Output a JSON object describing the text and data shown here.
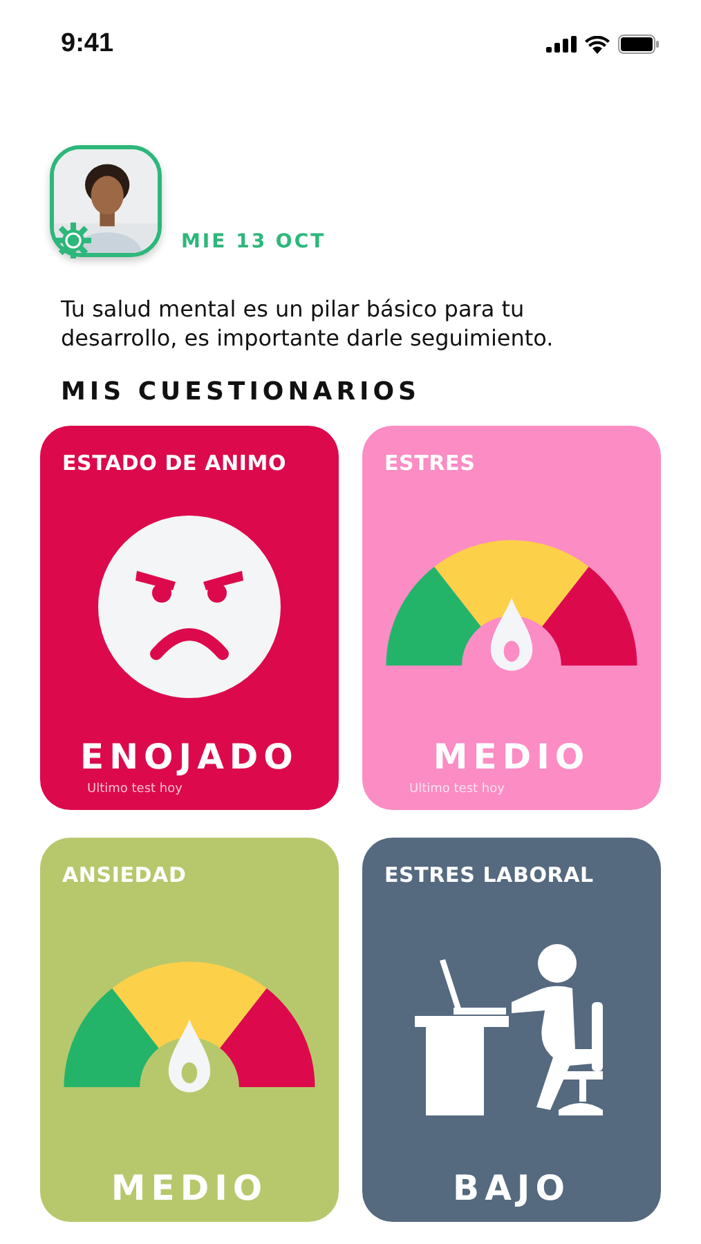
{
  "status_bar": {
    "time": "9:41"
  },
  "header": {
    "date": "MIE 13 OCT"
  },
  "intro": "Tu salud mental es un pilar básico para tu desarrollo, es importante darle seguimiento.",
  "section_title": "MIS CUESTIONARIOS",
  "cards": [
    {
      "title": "ESTADO DE ANIMO",
      "kind": "face",
      "color": "#dc0a4c",
      "result": "ENOJADO",
      "note": "Ultimo test hoy"
    },
    {
      "title": "ESTRES",
      "kind": "gauge",
      "color": "#fc8cc4",
      "result": "MEDIO",
      "note": "Ultimo test hoy"
    },
    {
      "title": "ANSIEDAD",
      "kind": "gauge",
      "color": "#b7c86c",
      "result": "MEDIO"
    },
    {
      "title": "ESTRES LABORAL",
      "kind": "desk",
      "color": "#55697f",
      "result": "BAJO"
    }
  ]
}
